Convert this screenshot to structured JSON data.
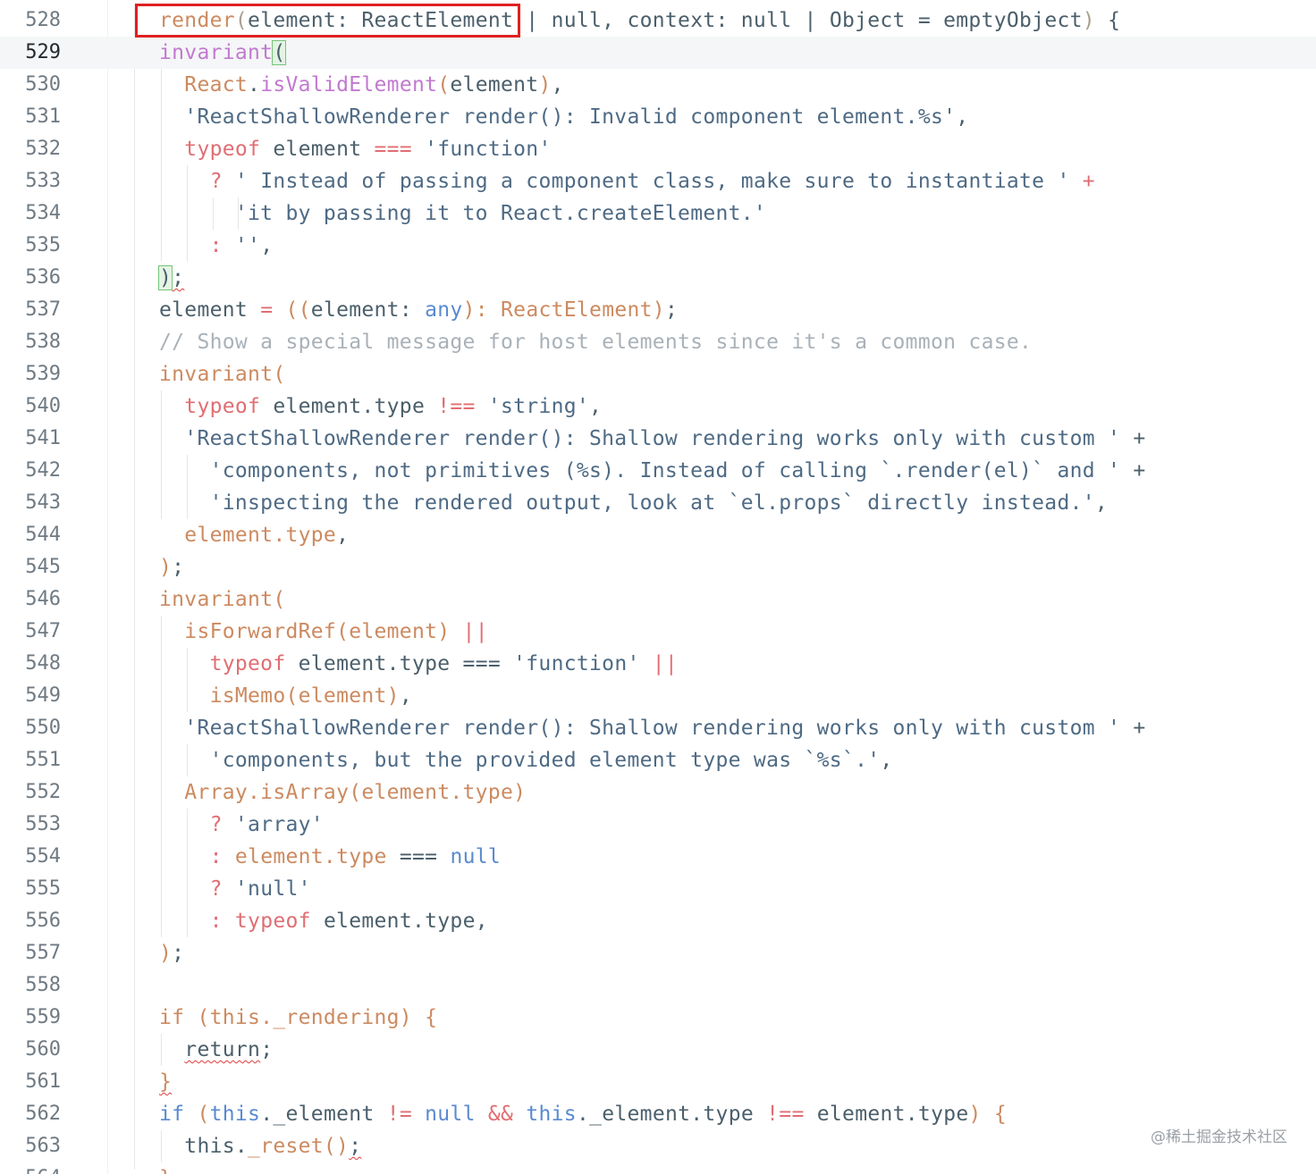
{
  "editor": {
    "first_line": 528,
    "current_line": 529,
    "watermark": "@稀土掘金技术社区",
    "lines": [
      {
        "n": "528",
        "t": [
          [
            "fn",
            "render"
          ],
          [
            "pn",
            "("
          ],
          [
            "pl",
            "element: ReactElement | null, context: null | Object = emptyObject"
          ],
          [
            "pn",
            ")"
          ],
          [
            "pl",
            " {"
          ]
        ]
      },
      {
        "n": "529",
        "t": [
          [
            "call",
            "invariant"
          ],
          [
            "bm",
            "("
          ]
        ]
      },
      {
        "n": "530",
        "t": [
          [
            "pl",
            "  "
          ],
          [
            "fn",
            "React"
          ],
          [
            "pl",
            "."
          ],
          [
            "call",
            "isValidElement"
          ],
          [
            "fn",
            "("
          ],
          [
            "pl",
            "element"
          ],
          [
            "fn",
            ")"
          ],
          [
            "pl",
            ","
          ]
        ]
      },
      {
        "n": "531",
        "t": [
          [
            "pl",
            "  "
          ],
          [
            "str",
            "'ReactShallowRenderer render(): Invalid component element.%s'"
          ],
          [
            "pl",
            ","
          ]
        ]
      },
      {
        "n": "532",
        "t": [
          [
            "pl",
            "  "
          ],
          [
            "kw",
            "typeof"
          ],
          [
            "pl",
            " element "
          ],
          [
            "op",
            "==="
          ],
          [
            "pl",
            " "
          ],
          [
            "str",
            "'function'"
          ]
        ]
      },
      {
        "n": "533",
        "t": [
          [
            "pl",
            "    "
          ],
          [
            "op",
            "?"
          ],
          [
            "pl",
            " "
          ],
          [
            "str",
            "' Instead of passing a component class, make sure to instantiate '"
          ],
          [
            "pl",
            " "
          ],
          [
            "op",
            "+"
          ]
        ]
      },
      {
        "n": "534",
        "t": [
          [
            "pl",
            "      "
          ],
          [
            "str",
            "'it by passing it to React.createElement.'"
          ]
        ]
      },
      {
        "n": "535",
        "t": [
          [
            "pl",
            "    "
          ],
          [
            "op",
            ":"
          ],
          [
            "pl",
            " "
          ],
          [
            "str",
            "''"
          ],
          [
            "pl",
            ","
          ]
        ]
      },
      {
        "n": "536",
        "t": [
          [
            "bm",
            ")"
          ],
          [
            "sq",
            ";"
          ]
        ]
      },
      {
        "n": "537",
        "t": [
          [
            "pl",
            "element "
          ],
          [
            "op",
            "="
          ],
          [
            "pl",
            " "
          ],
          [
            "fn",
            "(("
          ],
          [
            "pl",
            "element: "
          ],
          [
            "nl",
            "any"
          ],
          [
            "fn",
            "): ReactElement)"
          ],
          [
            "pl",
            ";"
          ]
        ]
      },
      {
        "n": "538",
        "t": [
          [
            "cm",
            "// Show a special message for host elements since it's a common case."
          ]
        ]
      },
      {
        "n": "539",
        "t": [
          [
            "fn",
            "invariant("
          ]
        ]
      },
      {
        "n": "540",
        "t": [
          [
            "pl",
            "  "
          ],
          [
            "kw",
            "typeof"
          ],
          [
            "pl",
            " element.type "
          ],
          [
            "op",
            "!=="
          ],
          [
            "pl",
            " "
          ],
          [
            "str",
            "'string'"
          ],
          [
            "pl",
            ","
          ]
        ]
      },
      {
        "n": "541",
        "t": [
          [
            "pl",
            "  "
          ],
          [
            "str",
            "'ReactShallowRenderer render(): Shallow rendering works only with custom '"
          ],
          [
            "pl",
            " +"
          ]
        ]
      },
      {
        "n": "542",
        "t": [
          [
            "pl",
            "    "
          ],
          [
            "str",
            "'components, not primitives (%s). Instead of calling `.render(el)` and '"
          ],
          [
            "pl",
            " +"
          ]
        ]
      },
      {
        "n": "543",
        "t": [
          [
            "pl",
            "    "
          ],
          [
            "str",
            "'inspecting the rendered output, look at `el.props` directly instead.'"
          ],
          [
            "pl",
            ","
          ]
        ]
      },
      {
        "n": "544",
        "t": [
          [
            "pl",
            "  "
          ],
          [
            "fn",
            "element.type"
          ],
          [
            "pl",
            ","
          ]
        ]
      },
      {
        "n": "545",
        "t": [
          [
            "fn",
            ")"
          ],
          [
            "pl",
            ";"
          ]
        ]
      },
      {
        "n": "546",
        "t": [
          [
            "fn",
            "invariant("
          ]
        ]
      },
      {
        "n": "547",
        "t": [
          [
            "pl",
            "  "
          ],
          [
            "fn",
            "isForwardRef(element)"
          ],
          [
            "pl",
            " "
          ],
          [
            "op",
            "||"
          ]
        ]
      },
      {
        "n": "548",
        "t": [
          [
            "pl",
            "    "
          ],
          [
            "kw",
            "typeof"
          ],
          [
            "pl",
            " element.type === "
          ],
          [
            "str",
            "'function'"
          ],
          [
            "pl",
            " "
          ],
          [
            "op",
            "||"
          ]
        ]
      },
      {
        "n": "549",
        "t": [
          [
            "pl",
            "    "
          ],
          [
            "fn",
            "isMemo(element)"
          ],
          [
            "pl",
            ","
          ]
        ]
      },
      {
        "n": "550",
        "t": [
          [
            "pl",
            "  "
          ],
          [
            "str",
            "'ReactShallowRenderer render(): Shallow rendering works only with custom '"
          ],
          [
            "pl",
            " +"
          ]
        ]
      },
      {
        "n": "551",
        "t": [
          [
            "pl",
            "    "
          ],
          [
            "str",
            "'components, but the provided element type was `%s`.'"
          ],
          [
            "pl",
            ","
          ]
        ]
      },
      {
        "n": "552",
        "t": [
          [
            "pl",
            "  "
          ],
          [
            "fn",
            "Array.isArray(element.type)"
          ]
        ]
      },
      {
        "n": "553",
        "t": [
          [
            "pl",
            "    "
          ],
          [
            "op",
            "?"
          ],
          [
            "pl",
            " "
          ],
          [
            "str",
            "'array'"
          ]
        ]
      },
      {
        "n": "554",
        "t": [
          [
            "pl",
            "    "
          ],
          [
            "op",
            ":"
          ],
          [
            "pl",
            " "
          ],
          [
            "fn",
            "element.type"
          ],
          [
            "pl",
            " === "
          ],
          [
            "nl",
            "null"
          ]
        ]
      },
      {
        "n": "555",
        "t": [
          [
            "pl",
            "    "
          ],
          [
            "op",
            "?"
          ],
          [
            "pl",
            " "
          ],
          [
            "str",
            "'null'"
          ]
        ]
      },
      {
        "n": "556",
        "t": [
          [
            "pl",
            "    "
          ],
          [
            "op",
            ":"
          ],
          [
            "pl",
            " "
          ],
          [
            "kw",
            "typeof"
          ],
          [
            "pl",
            " element.type,"
          ]
        ]
      },
      {
        "n": "557",
        "t": [
          [
            "fn",
            ")"
          ],
          [
            "pl",
            ";"
          ]
        ]
      },
      {
        "n": "558",
        "t": []
      },
      {
        "n": "559",
        "t": [
          [
            "fn",
            "if (this._rendering)"
          ],
          [
            "pl",
            " "
          ],
          [
            "fn",
            "{"
          ]
        ]
      },
      {
        "n": "560",
        "t": [
          [
            "pl",
            "  "
          ],
          [
            "sq",
            "return"
          ],
          [
            "pl",
            ";"
          ]
        ]
      },
      {
        "n": "561",
        "t": [
          [
            "sqf",
            "}"
          ]
        ]
      },
      {
        "n": "562",
        "t": [
          [
            "nl",
            "if"
          ],
          [
            "pl",
            " "
          ],
          [
            "fn",
            "("
          ],
          [
            "nl",
            "this"
          ],
          [
            "pl",
            "._element "
          ],
          [
            "op",
            "!="
          ],
          [
            "pl",
            " "
          ],
          [
            "nl",
            "null"
          ],
          [
            "pl",
            " "
          ],
          [
            "op",
            "&&"
          ],
          [
            "pl",
            " "
          ],
          [
            "nl",
            "this"
          ],
          [
            "pl",
            "._element.type "
          ],
          [
            "op",
            "!=="
          ],
          [
            "pl",
            " element.type"
          ],
          [
            "fn",
            ")"
          ],
          [
            "pl",
            " "
          ],
          [
            "fn",
            "{"
          ]
        ]
      },
      {
        "n": "563",
        "t": [
          [
            "pl",
            "  this."
          ],
          [
            "fn",
            "_reset()"
          ],
          [
            "sq",
            ";"
          ]
        ]
      },
      {
        "n": "564",
        "t": [
          [
            "fn",
            "}"
          ]
        ]
      }
    ]
  }
}
